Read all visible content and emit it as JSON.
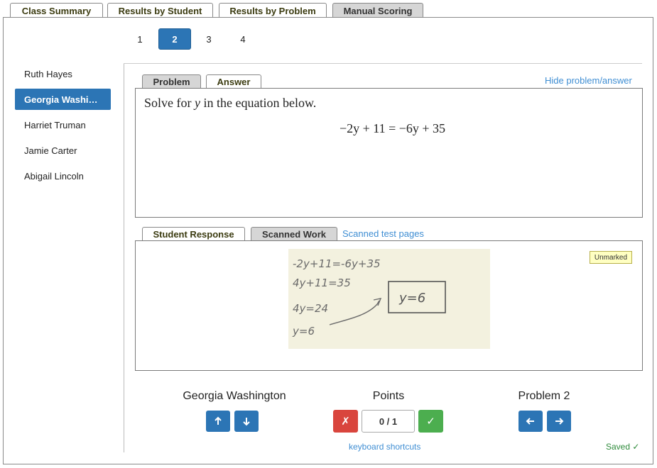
{
  "tabs": [
    {
      "label": "Class Summary"
    },
    {
      "label": "Results by Student"
    },
    {
      "label": "Results by Problem"
    },
    {
      "label": "Manual Scoring"
    }
  ],
  "pages": [
    "1",
    "2",
    "3",
    "4"
  ],
  "students": [
    "Ruth Hayes",
    "Georgia Washi…",
    "Harriet Truman",
    "Jamie Carter",
    "Abigail Lincoln"
  ],
  "problem_tabs": {
    "problem": "Problem",
    "answer": "Answer"
  },
  "hide_link": "Hide problem/answer",
  "problem": {
    "prompt_pre": "Solve for ",
    "prompt_var": "y",
    "prompt_post": " in the equation below.",
    "equation": "−2y + 11 = −6y + 35"
  },
  "response_tabs": {
    "student_response": "Student Response",
    "scanned_work": "Scanned Work"
  },
  "scanned_link": "Scanned test pages",
  "badge": "Unmarked",
  "handwriting": [
    "-2y+11=-6y+35",
    "4y+11=35",
    "4y=24",
    "y=6",
    "y=6"
  ],
  "footer": {
    "student_name": "Georgia Washington",
    "points_label": "Points",
    "score": "0 / 1",
    "problem_label": "Problem 2",
    "shortcuts": "keyboard shortcuts",
    "saved": "Saved ✓"
  }
}
